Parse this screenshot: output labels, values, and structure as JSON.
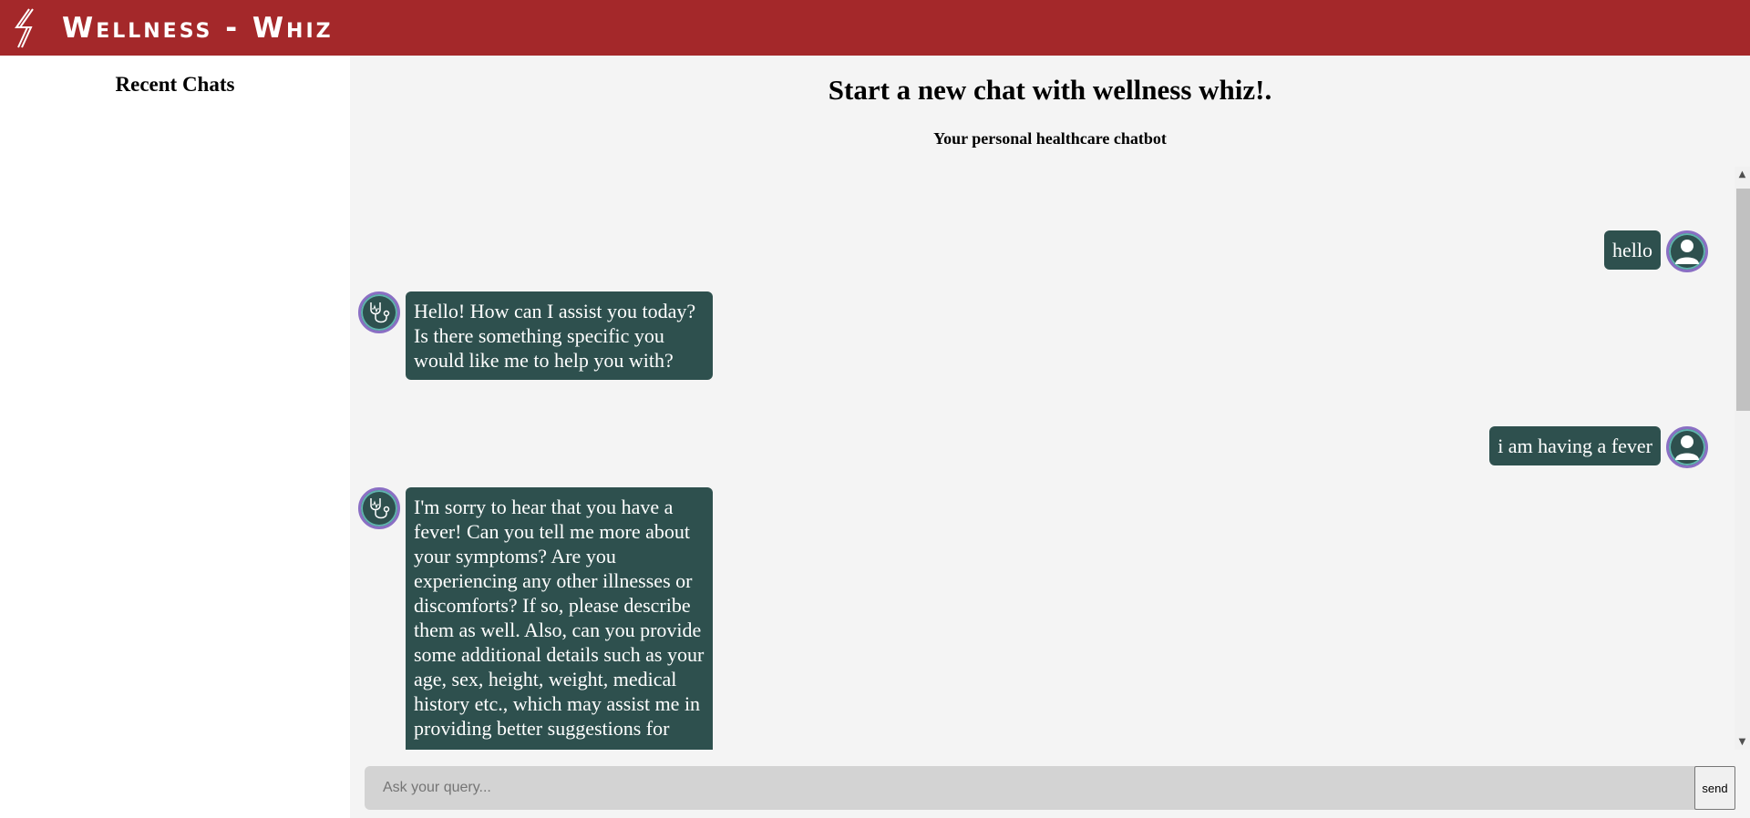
{
  "header": {
    "app_title": "Wellness - Whiz",
    "logo_icon": "lightning-slash-logo-icon"
  },
  "sidebar": {
    "title": "Recent Chats"
  },
  "main": {
    "title": "Start a new chat with wellness whiz!.",
    "subtitle": "Your personal healthcare chatbot"
  },
  "messages": [
    {
      "sender": "user",
      "text": "hello",
      "avatar_icon": "user-avatar-icon"
    },
    {
      "sender": "bot",
      "text": "Hello! How can I assist you today? Is there something specific you would like me to help you with?",
      "avatar_icon": "stethoscope-avatar-icon"
    },
    {
      "sender": "user",
      "text": "i am having a fever",
      "avatar_icon": "user-avatar-icon"
    },
    {
      "sender": "bot",
      "text": "I'm sorry to hear that you have a fever! Can you tell me more about your symptoms? Are you experiencing any other illnesses or discomforts? If so, please describe them as well. Also, can you provide some additional details such as your age, sex, height, weight, medical history etc., which may assist me in providing better suggestions for you.",
      "avatar_icon": "stethoscope-avatar-icon"
    }
  ],
  "input": {
    "placeholder": "Ask your query...",
    "value": "",
    "send_label": "send"
  },
  "colors": {
    "header_bg": "#a4282a",
    "bubble_bg": "#2e504e",
    "main_bg": "#f4f4f4",
    "input_bg": "#d3d3d3"
  }
}
